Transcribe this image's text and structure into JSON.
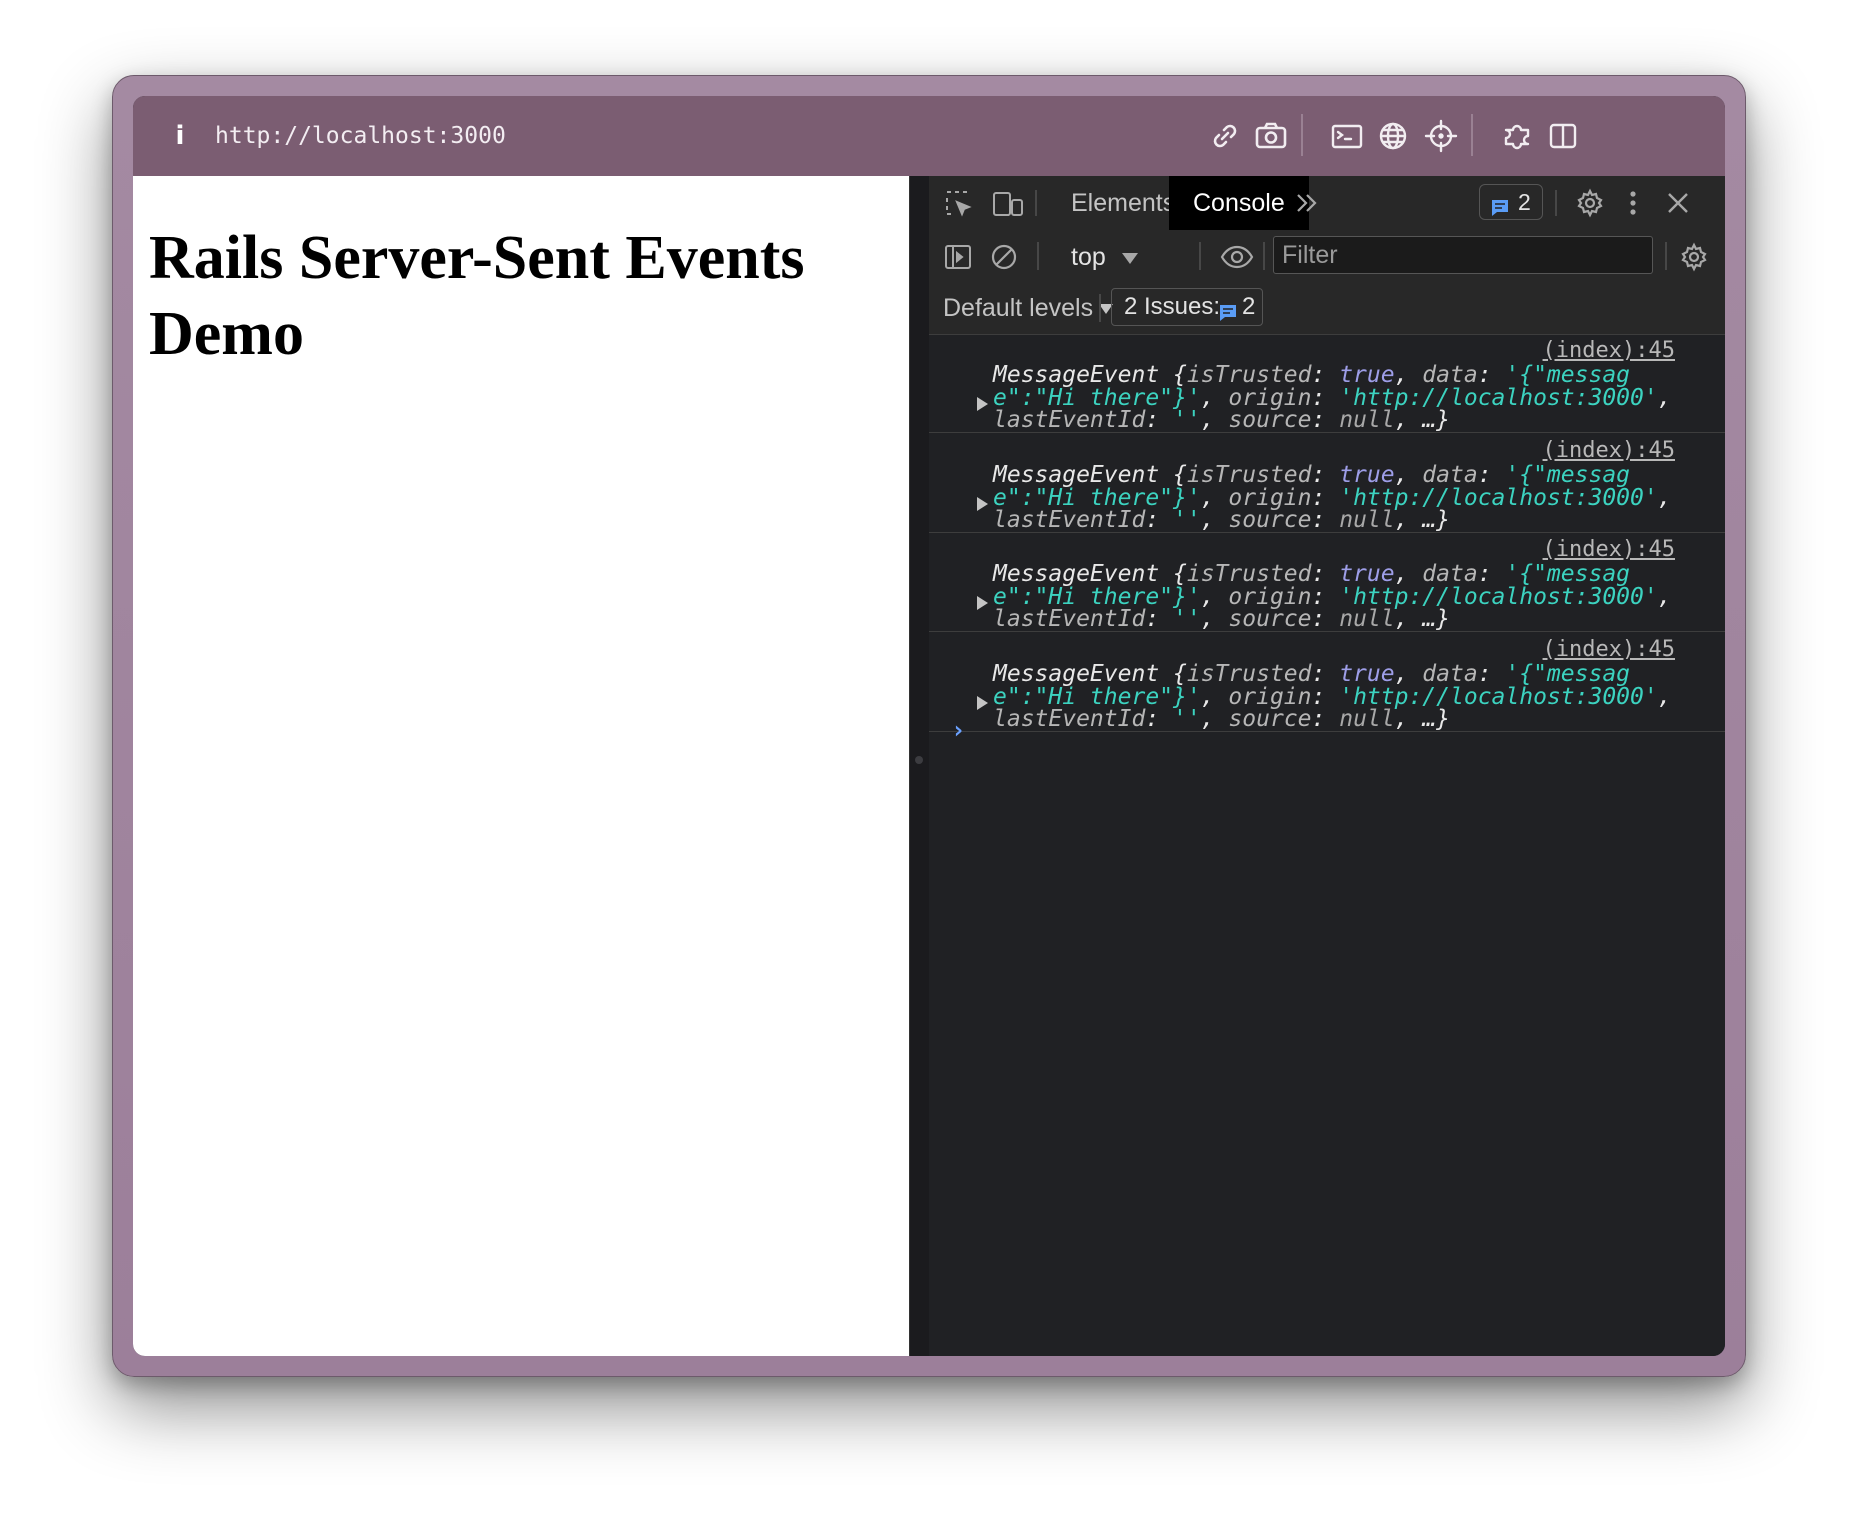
{
  "browser": {
    "url": "http://localhost:3000"
  },
  "page": {
    "heading": "Rails Server-Sent Events Demo"
  },
  "devtools": {
    "tabs": [
      "Elements",
      "Console"
    ],
    "issues_badge_count": "2",
    "context": "top",
    "filter_placeholder": "Filter",
    "levels_label": "Default levels",
    "issues_label": "2 Issues:",
    "issues_count": "2",
    "prompt_symbol": "›"
  },
  "logs": [
    {
      "source": "(index):45",
      "line1_a": "MessageEvent {",
      "line1_b": "isTrusted",
      "line1_c": ": ",
      "line1_d": "true",
      "line1_e": ", ",
      "line1_f": "data",
      "line1_g": ": ",
      "line1_h": "'{\"messag",
      "line2_a": "e\":\"Hi there\"}'",
      "line2_b": ", ",
      "line2_c": "origin",
      "line2_d": ": ",
      "line2_e": "'http://localhost:3000'",
      "line2_f": ",",
      "line3_a": "lastEventId",
      "line3_b": ": ",
      "line3_c": "''",
      "line3_d": ", ",
      "line3_e": "source",
      "line3_f": ": ",
      "line3_g": "null",
      "line3_h": ", …}"
    },
    {
      "source": "(index):45",
      "line1_a": "MessageEvent {",
      "line1_b": "isTrusted",
      "line1_c": ": ",
      "line1_d": "true",
      "line1_e": ", ",
      "line1_f": "data",
      "line1_g": ": ",
      "line1_h": "'{\"messag",
      "line2_a": "e\":\"Hi there\"}'",
      "line2_b": ", ",
      "line2_c": "origin",
      "line2_d": ": ",
      "line2_e": "'http://localhost:3000'",
      "line2_f": ",",
      "line3_a": "lastEventId",
      "line3_b": ": ",
      "line3_c": "''",
      "line3_d": ", ",
      "line3_e": "source",
      "line3_f": ": ",
      "line3_g": "null",
      "line3_h": ", …}"
    },
    {
      "source": "(index):45",
      "line1_a": "MessageEvent {",
      "line1_b": "isTrusted",
      "line1_c": ": ",
      "line1_d": "true",
      "line1_e": ", ",
      "line1_f": "data",
      "line1_g": ": ",
      "line1_h": "'{\"messag",
      "line2_a": "e\":\"Hi there\"}'",
      "line2_b": ", ",
      "line2_c": "origin",
      "line2_d": ": ",
      "line2_e": "'http://localhost:3000'",
      "line2_f": ",",
      "line3_a": "lastEventId",
      "line3_b": ": ",
      "line3_c": "''",
      "line3_d": ", ",
      "line3_e": "source",
      "line3_f": ": ",
      "line3_g": "null",
      "line3_h": ", …}"
    },
    {
      "source": "(index):45",
      "line1_a": "MessageEvent {",
      "line1_b": "isTrusted",
      "line1_c": ": ",
      "line1_d": "true",
      "line1_e": ", ",
      "line1_f": "data",
      "line1_g": ": ",
      "line1_h": "'{\"messag",
      "line2_a": "e\":\"Hi there\"}'",
      "line2_b": ", ",
      "line2_c": "origin",
      "line2_d": ": ",
      "line2_e": "'http://localhost:3000'",
      "line2_f": ",",
      "line3_a": "lastEventId",
      "line3_b": ": ",
      "line3_c": "''",
      "line3_d": ", ",
      "line3_e": "source",
      "line3_f": ": ",
      "line3_g": "null",
      "line3_h": ", …}"
    }
  ],
  "icons": {
    "info": "info-icon",
    "link": "link-icon",
    "camera": "camera-icon",
    "terminal": "terminal-icon",
    "globe": "globe-icon",
    "crosshair": "crosshair-icon",
    "extensions": "puzzle-icon",
    "split": "split-view-icon",
    "inspect": "inspect-element-icon",
    "device": "device-toolbar-icon",
    "more_tabs": "chevron-double-right-icon",
    "message": "message-icon",
    "settings": "gear-icon",
    "menu": "kebab-menu-icon",
    "close": "close-icon",
    "sidebar": "sidebar-toggle-icon",
    "clear": "clear-console-icon",
    "eye": "eye-icon"
  },
  "colors": {
    "toolbar": "#7b5d72",
    "frame": "#a48aa2",
    "devtools_bg": "#202124",
    "string": "#3cd3c0",
    "keyword": "#9e9ee8",
    "prompt": "#6aa1ff"
  }
}
